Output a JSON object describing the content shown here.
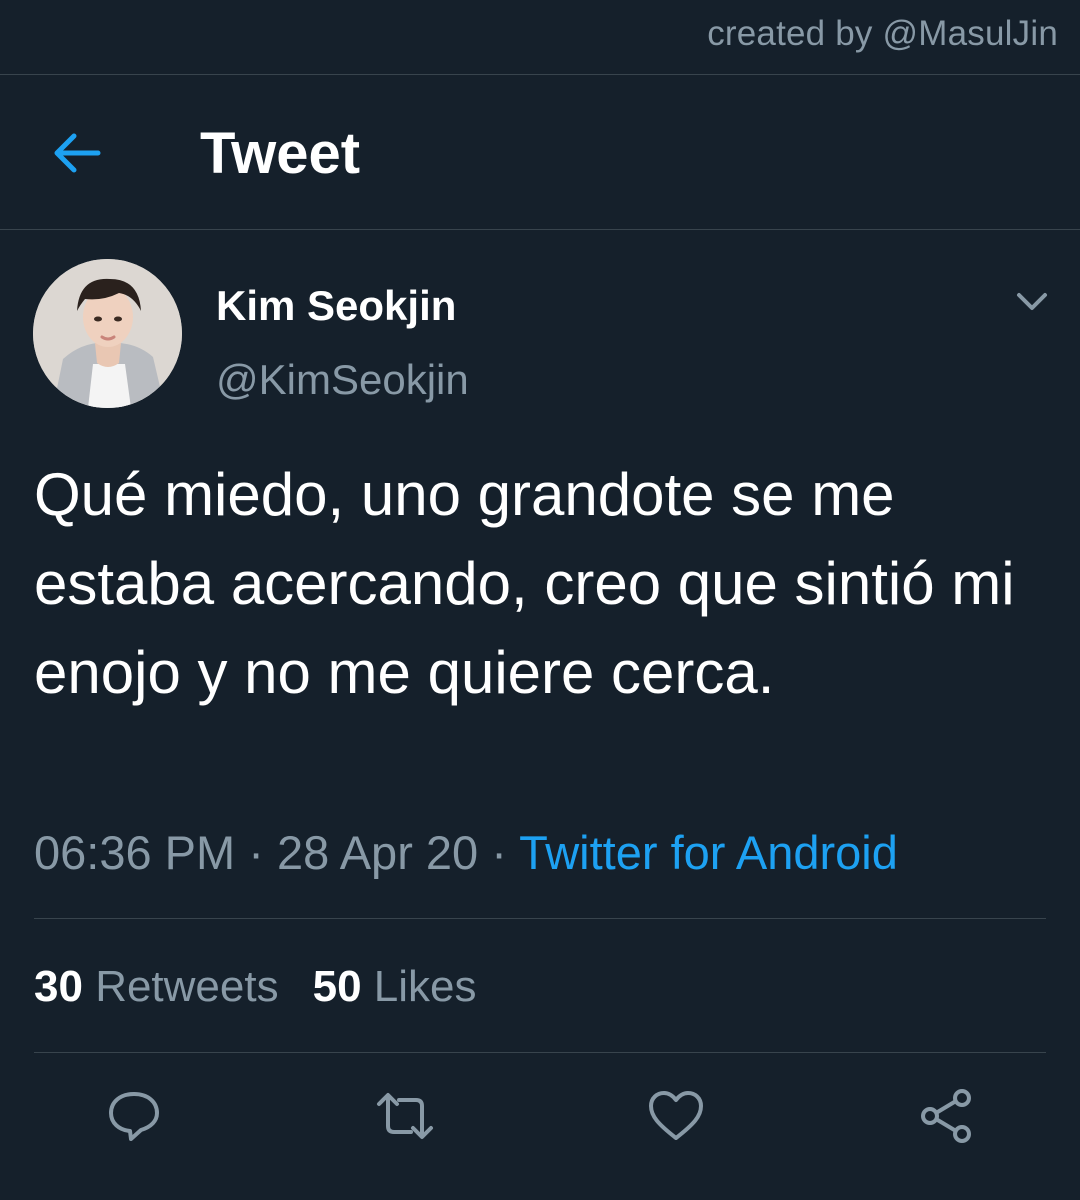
{
  "watermark": {
    "text": "created by @MasulJin"
  },
  "header": {
    "title": "Tweet",
    "back_icon": "arrow-left-icon"
  },
  "tweet": {
    "author": {
      "display_name": "Kim Seokjin",
      "handle": "@KimSeokjin"
    },
    "text": "Qué miedo, uno grandote se me estaba acercando, creo que sintió mi enojo y no me quiere cerca.",
    "time": "06:36 PM",
    "separator": " · ",
    "date": "28 Apr 20",
    "source": "Twitter for Android",
    "stats": {
      "retweets_count": "30",
      "retweets_label": "Retweets",
      "likes_count": "50",
      "likes_label": "Likes"
    },
    "actions": [
      "reply-icon",
      "retweet-icon",
      "like-icon",
      "share-icon"
    ]
  },
  "colors": {
    "background": "#15202b",
    "accent": "#1da1f2",
    "secondary_text": "#8899a6",
    "divider": "#38444d"
  }
}
